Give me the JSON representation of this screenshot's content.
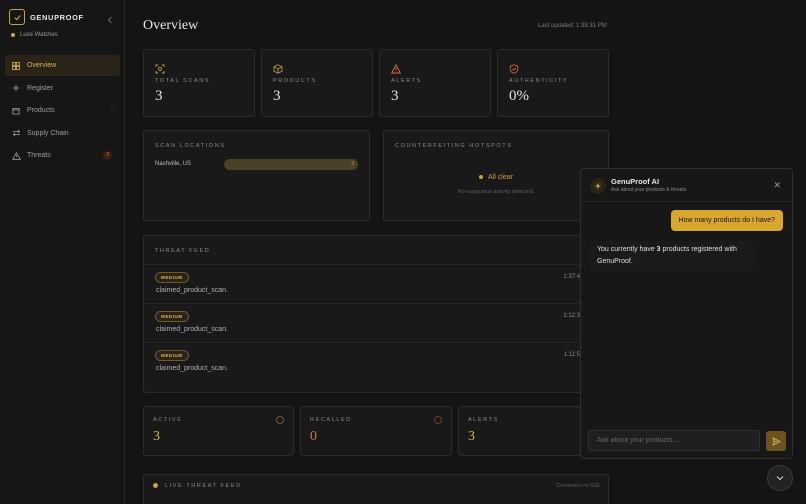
{
  "brand": {
    "name": "GENUPROOF",
    "org": "Luxe Watches"
  },
  "sidebar": {
    "items": [
      {
        "label": "Overview"
      },
      {
        "label": "Register"
      },
      {
        "label": "Products",
        "indicator": "›"
      },
      {
        "label": "Supply Chain"
      },
      {
        "label": "Threats",
        "badge": "3"
      }
    ]
  },
  "header": {
    "title": "Overview",
    "updated": "Last updated: 1:38:31 PM"
  },
  "stats": [
    {
      "label": "Total Scans",
      "value": "3",
      "icon": "scan-icon"
    },
    {
      "label": "Products",
      "value": "3",
      "icon": "box-icon"
    },
    {
      "label": "Alerts",
      "value": "3",
      "icon": "warning-icon"
    },
    {
      "label": "Authenticity",
      "value": "0%",
      "icon": "shield-icon"
    }
  ],
  "scan_locations": {
    "label": "Scan Locations",
    "items": [
      {
        "name": "Nashville, US",
        "count": "3",
        "fraction": 1.0
      }
    ]
  },
  "hotspots": {
    "label": "Counterfeiting Hotspots",
    "status": "All clear",
    "message": "No suspicious activity detected."
  },
  "threat_feed": {
    "label": "Threat Feed",
    "items": [
      {
        "severity": "MEDIUM",
        "text": "claimed_product_scan.",
        "time": "1:37:4"
      },
      {
        "severity": "MEDIUM",
        "text": "claimed_product_scan.",
        "time": "1:12:3"
      },
      {
        "severity": "MEDIUM",
        "text": "claimed_product_scan.",
        "time": "1:11:5"
      }
    ]
  },
  "mini_stats": [
    {
      "label": "Active",
      "value": "3"
    },
    {
      "label": "Recalled",
      "value": "0"
    },
    {
      "label": "Alerts",
      "value": "3"
    }
  ],
  "live_feed": {
    "label": "Live Threat Feed",
    "connection": "Connected via SSE"
  },
  "chat": {
    "title": "GenuProof AI",
    "subtitle": "Ask about your products & threats",
    "user_message": "How many products do I have?",
    "ai_before": "You currently have ",
    "ai_number": "3",
    "ai_after": " products registered with GenuProof.",
    "input_placeholder": "Ask about your products..."
  },
  "colors": {
    "accent": "#d9a62e",
    "gold_text": "#d9b45a",
    "danger": "#d9704a",
    "success": "#c8a24a",
    "background": "#141414"
  }
}
